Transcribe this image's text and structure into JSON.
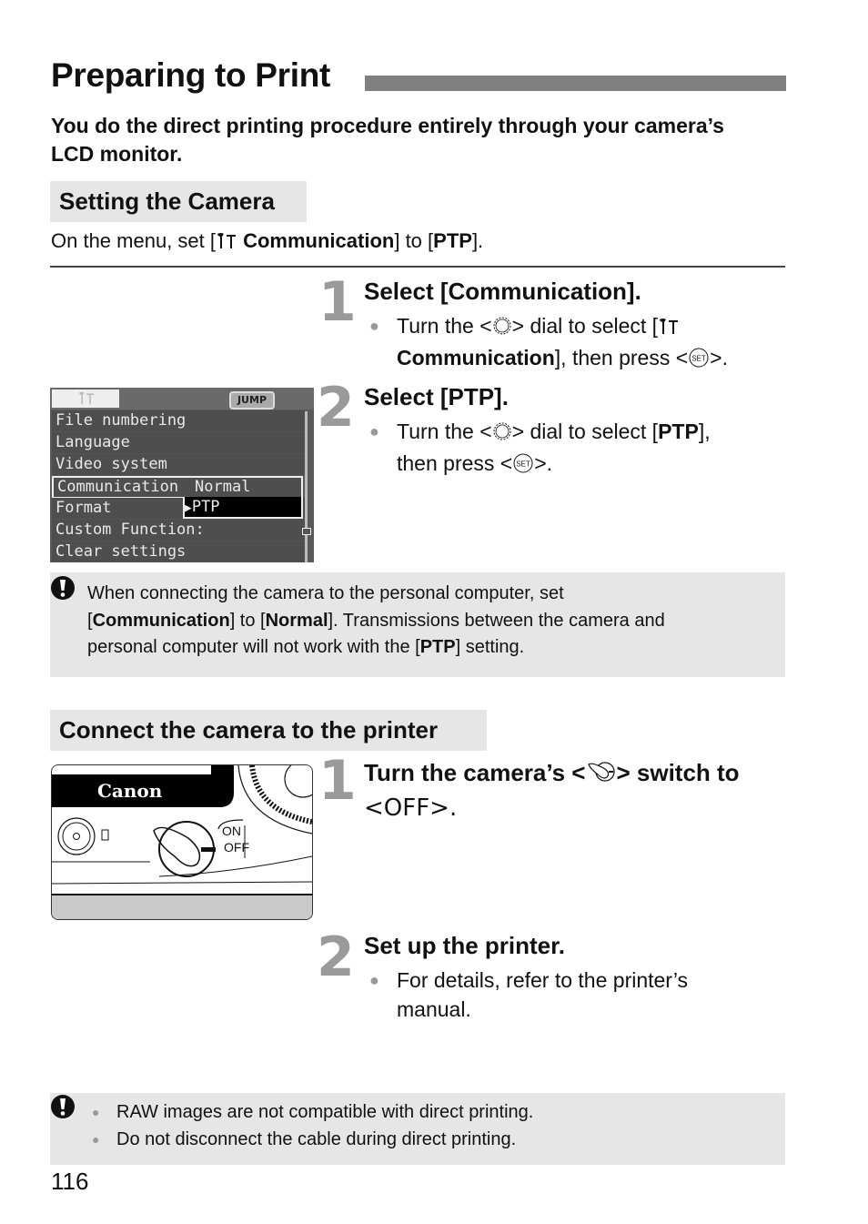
{
  "page": {
    "title": "Preparing to Print",
    "intro": "You do the direct printing procedure entirely through your camera’s LCD monitor.",
    "page_number": "116"
  },
  "section1": {
    "heading": "Setting the Camera",
    "lead": {
      "prefix": "On the menu, set [",
      "icon": "setup-menu-icon",
      "bold1": "Communication",
      "mid": "] to [",
      "bold2": "PTP",
      "suffix": "]."
    },
    "lcd_menu": {
      "tab_icon": "setup-menu-icon",
      "jump_label": "JUMP",
      "items": [
        "File numbering",
        "Language",
        "Video system",
        "Communication",
        "Format",
        "Custom Function:",
        "Clear settings"
      ],
      "selected_item": "Communication",
      "current_value": "Normal",
      "option_highlighted": "PTP"
    },
    "steps": [
      {
        "number": "1",
        "title": "Select [Communication].",
        "bullet": {
          "t1": "Turn the <",
          "dial_icon": "quick-control-dial-icon",
          "t2": "> dial to select [",
          "setup_icon": "setup-menu-icon",
          "bold": "Communication",
          "t3": "], then press <",
          "set_icon": "set-button-icon",
          "t4": ">."
        }
      },
      {
        "number": "2",
        "title": "Select [PTP].",
        "bullet": {
          "t1": "Turn the <",
          "dial_icon": "quick-control-dial-icon",
          "t2": "> dial to select [",
          "bold": "PTP",
          "t3": "],",
          "t4": "then press <",
          "set_icon": "set-button-icon",
          "t5": ">."
        }
      }
    ],
    "caution": {
      "icon": "caution-icon",
      "l1": "When connecting the camera to the personal computer, set",
      "l2a": "[",
      "l2b": "Communication",
      "l2c": "] to [",
      "l2d": "Normal",
      "l2e": "]. Transmissions between the camera and",
      "l3a": "personal computer will not work with the [",
      "l3b": "PTP",
      "l3c": "] setting."
    }
  },
  "section2": {
    "heading": "Connect the camera to the printer",
    "illustration": {
      "brand": "Canon",
      "switch_on": "ON",
      "switch_off": "OFF"
    },
    "steps": [
      {
        "number": "1",
        "title_a": "Turn the camera’s <",
        "switch_icon": "power-switch-icon",
        "title_b": "> switch to",
        "title_c": "<OFF>."
      },
      {
        "number": "2",
        "title": "Set up the printer.",
        "bullet_l1": "For details, refer to the printer’s",
        "bullet_l2": "manual."
      }
    ],
    "caution": {
      "icon": "caution-icon",
      "items": [
        "RAW images are not compatible with direct printing.",
        "Do not disconnect the cable during direct printing."
      ]
    }
  }
}
